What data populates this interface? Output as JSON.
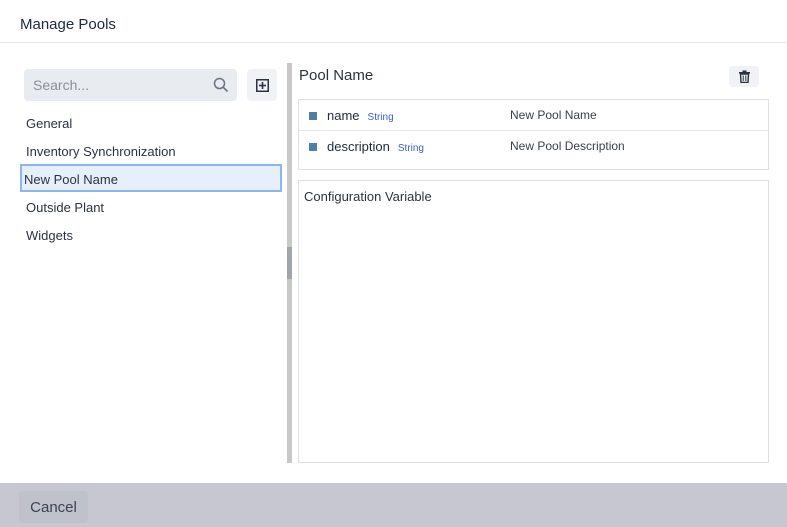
{
  "dialog": {
    "title": "Manage Pools"
  },
  "sidebar": {
    "search_placeholder": "Search...",
    "search_icon": "search-icon",
    "add_icon": "plus-square-icon",
    "items": [
      {
        "label": "General",
        "selected": false
      },
      {
        "label": "Inventory Synchronization",
        "selected": false
      },
      {
        "label": "New Pool Name",
        "selected": true
      },
      {
        "label": "Outside Plant",
        "selected": false
      },
      {
        "label": "Widgets",
        "selected": false
      }
    ]
  },
  "detail": {
    "title": "Pool Name",
    "delete_icon": "trash-icon",
    "properties": [
      {
        "name": "name",
        "type": "String",
        "value": "New Pool Name"
      },
      {
        "name": "description",
        "type": "String",
        "value": "New Pool Description"
      }
    ],
    "config_label": "Configuration Variable"
  },
  "footer": {
    "cancel_label": "Cancel"
  },
  "colors": {
    "selected_bg": "#e6f0fb",
    "selected_border": "#8bb7ec",
    "type_label": "#3d5bd0",
    "marker": "#4f7fa3",
    "footer_bg": "#c6c7d0"
  }
}
